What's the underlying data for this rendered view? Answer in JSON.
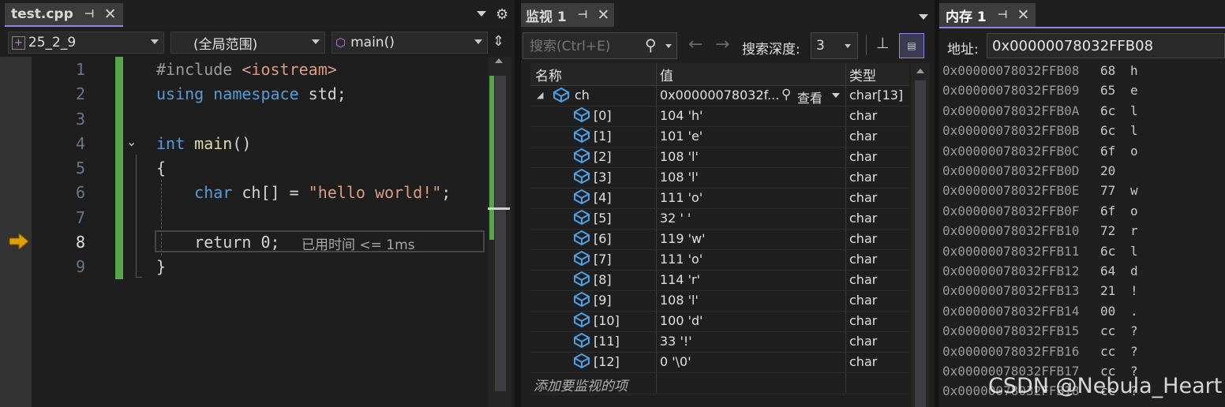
{
  "editor": {
    "tab_title": "test.cpp",
    "project_dropdown": "25_2_9",
    "scope_dropdown": "(全局范围)",
    "function_dropdown": "main()",
    "current_line": 8,
    "lines": [
      {
        "num": "1",
        "parts": [
          {
            "t": "#include ",
            "c": "pre"
          },
          {
            "t": "<iostream>",
            "c": "inc"
          }
        ]
      },
      {
        "num": "2",
        "parts": [
          {
            "t": "using",
            "c": "kw"
          },
          {
            "t": " ",
            "c": ""
          },
          {
            "t": "namespace",
            "c": "kw"
          },
          {
            "t": " std;",
            "c": ""
          }
        ]
      },
      {
        "num": "3",
        "parts": []
      },
      {
        "num": "4",
        "parts": [
          {
            "t": "int",
            "c": "kw"
          },
          {
            "t": " ",
            "c": ""
          },
          {
            "t": "main",
            "c": "fn"
          },
          {
            "t": "()",
            "c": ""
          }
        ]
      },
      {
        "num": "5",
        "parts": [
          {
            "t": "{",
            "c": ""
          }
        ]
      },
      {
        "num": "6",
        "parts": [
          {
            "t": "    ",
            "c": ""
          },
          {
            "t": "char",
            "c": "kw"
          },
          {
            "t": " ch[] = ",
            "c": ""
          },
          {
            "t": "\"hello world!\"",
            "c": "str"
          },
          {
            "t": ";",
            "c": ""
          }
        ]
      },
      {
        "num": "7",
        "parts": []
      },
      {
        "num": "8",
        "parts": [
          {
            "t": "    return 0;",
            "c": ""
          }
        ]
      },
      {
        "num": "9",
        "parts": [
          {
            "t": "}",
            "c": ""
          }
        ]
      }
    ],
    "elapsed_hint": "已用时间 <= 1ms"
  },
  "watch": {
    "tab_title": "监视 1",
    "search_placeholder": "搜索(Ctrl+E)",
    "search_depth_label": "搜索深度:",
    "search_depth_value": "3",
    "columns": {
      "name": "名称",
      "value": "值",
      "type": "类型"
    },
    "root": {
      "name": "ch",
      "value": "0x00000078032f...",
      "view_label": "查看",
      "type": "char[13]"
    },
    "items": [
      {
        "name": "[0]",
        "value": "104 'h'",
        "type": "char"
      },
      {
        "name": "[1]",
        "value": "101 'e'",
        "type": "char"
      },
      {
        "name": "[2]",
        "value": "108 'l'",
        "type": "char"
      },
      {
        "name": "[3]",
        "value": "108 'l'",
        "type": "char"
      },
      {
        "name": "[4]",
        "value": "111 'o'",
        "type": "char"
      },
      {
        "name": "[5]",
        "value": "32 ' '",
        "type": "char"
      },
      {
        "name": "[6]",
        "value": "119 'w'",
        "type": "char"
      },
      {
        "name": "[7]",
        "value": "111 'o'",
        "type": "char"
      },
      {
        "name": "[8]",
        "value": "114 'r'",
        "type": "char"
      },
      {
        "name": "[9]",
        "value": "108 'l'",
        "type": "char"
      },
      {
        "name": "[10]",
        "value": "100 'd'",
        "type": "char"
      },
      {
        "name": "[11]",
        "value": "33 '!'",
        "type": "char"
      },
      {
        "name": "[12]",
        "value": "0 '\\0'",
        "type": "char"
      }
    ],
    "add_item_placeholder": "添加要监视的项"
  },
  "memory": {
    "tab_title": "内存 1",
    "address_label": "地址:",
    "address_value": "0x00000078032FFB08",
    "rows": [
      {
        "addr": "0x00000078032FFB08",
        "hex": "68",
        "ch": "h"
      },
      {
        "addr": "0x00000078032FFB09",
        "hex": "65",
        "ch": "e"
      },
      {
        "addr": "0x00000078032FFB0A",
        "hex": "6c",
        "ch": "l"
      },
      {
        "addr": "0x00000078032FFB0B",
        "hex": "6c",
        "ch": "l"
      },
      {
        "addr": "0x00000078032FFB0C",
        "hex": "6f",
        "ch": "o"
      },
      {
        "addr": "0x00000078032FFB0D",
        "hex": "20",
        "ch": ""
      },
      {
        "addr": "0x00000078032FFB0E",
        "hex": "77",
        "ch": "w"
      },
      {
        "addr": "0x00000078032FFB0F",
        "hex": "6f",
        "ch": "o"
      },
      {
        "addr": "0x00000078032FFB10",
        "hex": "72",
        "ch": "r"
      },
      {
        "addr": "0x00000078032FFB11",
        "hex": "6c",
        "ch": "l"
      },
      {
        "addr": "0x00000078032FFB12",
        "hex": "64",
        "ch": "d"
      },
      {
        "addr": "0x00000078032FFB13",
        "hex": "21",
        "ch": "!"
      },
      {
        "addr": "0x00000078032FFB14",
        "hex": "00",
        "ch": "."
      },
      {
        "addr": "0x00000078032FFB15",
        "hex": "cc",
        "ch": "?"
      },
      {
        "addr": "0x00000078032FFB16",
        "hex": "cc",
        "ch": "?"
      },
      {
        "addr": "0x00000078032FFB17",
        "hex": "cc",
        "ch": "?"
      },
      {
        "addr": "0x00000078032FFB18",
        "hex": "cc",
        "ch": "?"
      }
    ]
  },
  "watermark": "CSDN @Nebula_Heart",
  "colors": {
    "accent": "#9184ee",
    "tab_active": "#3d3d3d",
    "keyword": "#569cd6",
    "string": "#d69d85",
    "change_bar": "#57a64a"
  }
}
